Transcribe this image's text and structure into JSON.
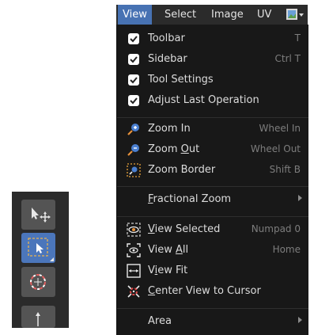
{
  "menubar": {
    "items": [
      {
        "label": "View",
        "active": true
      },
      {
        "label": "Select",
        "active": false
      },
      {
        "label": "Image",
        "active": false
      },
      {
        "label": "UV",
        "active": false
      }
    ],
    "editor_icon": "image-editor-icon"
  },
  "menu": {
    "checks": [
      {
        "label": "Toolbar",
        "shortcut": "T"
      },
      {
        "label": "Sidebar",
        "shortcut": "Ctrl T"
      },
      {
        "label": "Tool Settings",
        "shortcut": ""
      },
      {
        "label": "Adjust Last Operation",
        "shortcut": ""
      }
    ],
    "zoom": [
      {
        "label": "Zoom In",
        "shortcut": "Wheel In",
        "icon": "zoom-in-icon"
      },
      {
        "label": "Zoom Out",
        "shortcut": "Wheel Out",
        "icon": "zoom-out-icon"
      },
      {
        "label": "Zoom Border",
        "shortcut": "Shift B",
        "icon": "zoom-border-icon"
      }
    ],
    "fractional_zoom": "Fractional Zoom",
    "view": [
      {
        "label": "View Selected",
        "shortcut": "Numpad 0",
        "icon": "view-selected-icon"
      },
      {
        "label": "View All",
        "shortcut": "Home",
        "icon": "view-all-icon"
      },
      {
        "label": "View Fit",
        "shortcut": "",
        "icon": "view-fit-icon"
      },
      {
        "label": "Center View to Cursor",
        "shortcut": "",
        "icon": "center-cursor-icon"
      }
    ],
    "area": "Area"
  },
  "toolbar": {
    "tools": [
      {
        "name": "grab-tool",
        "icon": "move-cursor-icon"
      },
      {
        "name": "select-box-tool",
        "icon": "select-box-icon",
        "active": true
      },
      {
        "name": "cursor-tool",
        "icon": "3d-cursor-icon"
      },
      {
        "name": "transform-tool",
        "icon": "arrow-up-icon"
      }
    ]
  },
  "colors": {
    "accent": "#4772b3",
    "menu_bg": "#181818",
    "menubar_bg": "#2b2b2b"
  }
}
